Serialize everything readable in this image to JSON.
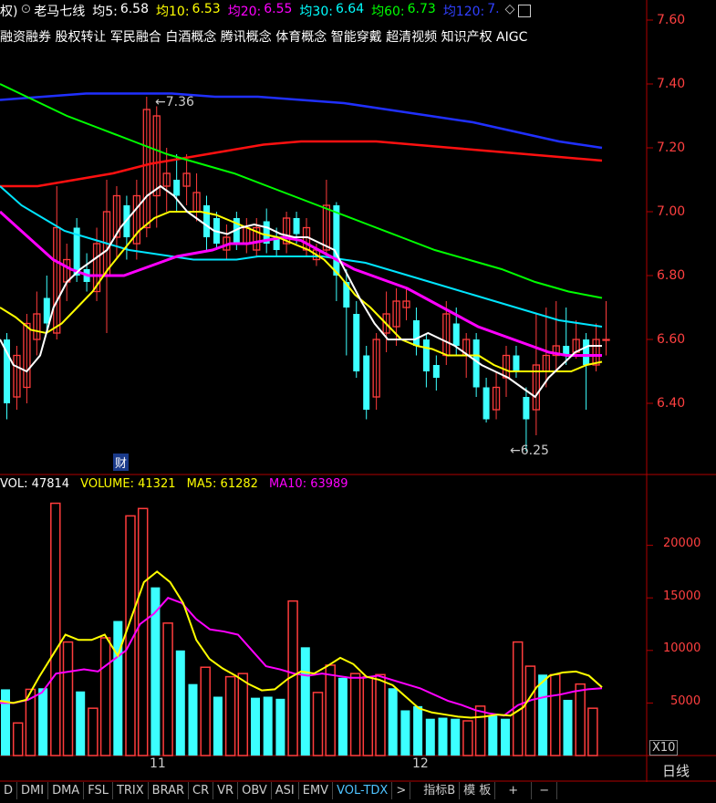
{
  "header": {
    "prefix": "权)",
    "stock_name": "老马七线",
    "ma5": {
      "label": "均5:",
      "value": "6.58",
      "color": "#ffffff"
    },
    "ma10": {
      "label": "均10:",
      "value": "6.53",
      "color": "#ffff00"
    },
    "ma20": {
      "label": "均20:",
      "value": "6.55",
      "color": "#ff00ff"
    },
    "ma30": {
      "label": "均30:",
      "value": "6.64",
      "color": "#00ffff"
    },
    "ma60": {
      "label": "均60:",
      "value": "6.73",
      "color": "#00ff00"
    },
    "ma120": {
      "label": "均120:",
      "value": "7.",
      "color": "#3040ff"
    }
  },
  "concepts": "融资融券 股权转让 军民融合 白酒概念 腾讯概念 体育概念 智能穿戴 超清视频 知识产权 AIGC",
  "price_axis": [
    "7.60",
    "7.40",
    "7.20",
    "7.00",
    "6.80",
    "6.60",
    "6.40"
  ],
  "annotations": {
    "high": "7.36",
    "low": "6.25",
    "cai": "财"
  },
  "volume_header": {
    "vol": {
      "label": "VOL:",
      "value": "47814",
      "color": "#ffffff"
    },
    "volume": {
      "label": "VOLUME:",
      "value": "41321",
      "color": "#ffff00"
    },
    "ma5": {
      "label": "MA5:",
      "value": "61282",
      "color": "#ffff00"
    },
    "ma10": {
      "label": "MA10:",
      "value": "63989",
      "color": "#ff00ff"
    }
  },
  "volume_axis": [
    "20000",
    "15000",
    "10000",
    "5000"
  ],
  "volume_unit": "X10",
  "x_axis": [
    "11",
    "12"
  ],
  "period": "日线",
  "tabs": [
    "D",
    "DMI",
    "DMA",
    "FSL",
    "TRIX",
    "BRAR",
    "CR",
    "VR",
    "OBV",
    "ASI",
    "EMV",
    "VOL-TDX",
    ">",
    "指标B",
    "模 板",
    "+",
    "−"
  ],
  "active_tab": "VOL-TDX",
  "chart_data": {
    "type": "candlestick",
    "candles": [
      {
        "o": 6.4,
        "c": 6.6,
        "h": 6.62,
        "l": 6.35,
        "up": false
      },
      {
        "o": 6.42,
        "c": 6.55,
        "h": 6.58,
        "l": 6.38,
        "up": true
      },
      {
        "o": 6.45,
        "c": 6.65,
        "h": 6.68,
        "l": 6.4,
        "up": true
      },
      {
        "o": 6.6,
        "c": 6.68,
        "h": 6.75,
        "l": 6.55,
        "up": true
      },
      {
        "o": 6.65,
        "c": 6.73,
        "h": 6.8,
        "l": 6.62,
        "up": false
      },
      {
        "o": 6.62,
        "c": 6.95,
        "h": 7.08,
        "l": 6.6,
        "up": true
      },
      {
        "o": 6.78,
        "c": 6.85,
        "h": 6.9,
        "l": 6.72,
        "up": true
      },
      {
        "o": 6.8,
        "c": 6.95,
        "h": 6.98,
        "l": 6.78,
        "up": false
      },
      {
        "o": 6.78,
        "c": 6.82,
        "h": 6.87,
        "l": 6.75,
        "up": false
      },
      {
        "o": 6.75,
        "c": 6.9,
        "h": 6.95,
        "l": 6.72,
        "up": true
      },
      {
        "o": 6.8,
        "c": 7.0,
        "h": 7.1,
        "l": 6.62,
        "up": true
      },
      {
        "o": 6.92,
        "c": 7.05,
        "h": 7.08,
        "l": 6.85,
        "up": true
      },
      {
        "o": 6.92,
        "c": 7.02,
        "h": 7.05,
        "l": 6.85,
        "up": false
      },
      {
        "o": 6.9,
        "c": 7.05,
        "h": 7.1,
        "l": 6.85,
        "up": true
      },
      {
        "o": 6.95,
        "c": 7.32,
        "h": 7.36,
        "l": 6.92,
        "up": true
      },
      {
        "o": 7.3,
        "c": 7.05,
        "h": 7.33,
        "l": 6.95,
        "up": true
      },
      {
        "o": 7.08,
        "c": 7.12,
        "h": 7.2,
        "l": 7.0,
        "up": true
      },
      {
        "o": 7.1,
        "c": 7.05,
        "h": 7.18,
        "l": 7.0,
        "up": false
      },
      {
        "o": 7.12,
        "c": 7.08,
        "h": 7.18,
        "l": 7.02,
        "up": true
      },
      {
        "o": 7.06,
        "c": 7.0,
        "h": 7.12,
        "l": 6.97,
        "up": true
      },
      {
        "o": 7.02,
        "c": 6.92,
        "h": 7.05,
        "l": 6.88,
        "up": false
      },
      {
        "o": 6.98,
        "c": 6.9,
        "h": 7.0,
        "l": 6.88,
        "up": false
      },
      {
        "o": 6.92,
        "c": 6.88,
        "h": 6.96,
        "l": 6.85,
        "up": true
      },
      {
        "o": 6.98,
        "c": 6.9,
        "h": 7.0,
        "l": 6.88,
        "up": false
      },
      {
        "o": 6.9,
        "c": 6.95,
        "h": 6.98,
        "l": 6.87,
        "up": true
      },
      {
        "o": 6.95,
        "c": 6.88,
        "h": 6.98,
        "l": 6.86,
        "up": true
      },
      {
        "o": 6.97,
        "c": 6.9,
        "h": 7.01,
        "l": 6.87,
        "up": false
      },
      {
        "o": 6.92,
        "c": 6.88,
        "h": 6.95,
        "l": 6.86,
        "up": false
      },
      {
        "o": 6.98,
        "c": 6.9,
        "h": 7.0,
        "l": 6.87,
        "up": true
      },
      {
        "o": 6.98,
        "c": 6.93,
        "h": 7.0,
        "l": 6.9,
        "up": false
      },
      {
        "o": 6.95,
        "c": 6.88,
        "h": 6.98,
        "l": 6.86,
        "up": true
      },
      {
        "o": 6.85,
        "c": 6.88,
        "h": 6.9,
        "l": 6.83,
        "up": true
      },
      {
        "o": 6.88,
        "c": 7.02,
        "h": 7.1,
        "l": 6.86,
        "up": true
      },
      {
        "o": 7.02,
        "c": 6.8,
        "h": 7.03,
        "l": 6.72,
        "up": false
      },
      {
        "o": 6.78,
        "c": 6.7,
        "h": 6.82,
        "l": 6.55,
        "up": false
      },
      {
        "o": 6.68,
        "c": 6.5,
        "h": 6.72,
        "l": 6.48,
        "up": false
      },
      {
        "o": 6.55,
        "c": 6.38,
        "h": 6.58,
        "l": 6.35,
        "up": false
      },
      {
        "o": 6.42,
        "c": 6.6,
        "h": 6.62,
        "l": 6.38,
        "up": true
      },
      {
        "o": 6.62,
        "c": 6.68,
        "h": 6.75,
        "l": 6.56,
        "up": true
      },
      {
        "o": 6.64,
        "c": 6.72,
        "h": 6.76,
        "l": 6.58,
        "up": true
      },
      {
        "o": 6.7,
        "c": 6.72,
        "h": 6.76,
        "l": 6.66,
        "up": true
      },
      {
        "o": 6.66,
        "c": 6.58,
        "h": 6.7,
        "l": 6.55,
        "up": false
      },
      {
        "o": 6.6,
        "c": 6.5,
        "h": 6.62,
        "l": 6.45,
        "up": false
      },
      {
        "o": 6.52,
        "c": 6.48,
        "h": 6.55,
        "l": 6.44,
        "up": false
      },
      {
        "o": 6.55,
        "c": 6.68,
        "h": 6.72,
        "l": 6.52,
        "up": true
      },
      {
        "o": 6.65,
        "c": 6.58,
        "h": 6.7,
        "l": 6.55,
        "up": false
      },
      {
        "o": 6.55,
        "c": 6.6,
        "h": 6.62,
        "l": 6.48,
        "up": true
      },
      {
        "o": 6.6,
        "c": 6.45,
        "h": 6.62,
        "l": 6.42,
        "up": false
      },
      {
        "o": 6.45,
        "c": 6.35,
        "h": 6.48,
        "l": 6.34,
        "up": false
      },
      {
        "o": 6.38,
        "c": 6.45,
        "h": 6.5,
        "l": 6.35,
        "up": true
      },
      {
        "o": 6.48,
        "c": 6.55,
        "h": 6.58,
        "l": 6.42,
        "up": true
      },
      {
        "o": 6.55,
        "c": 6.5,
        "h": 6.58,
        "l": 6.48,
        "up": false
      },
      {
        "o": 6.42,
        "c": 6.35,
        "h": 6.45,
        "l": 6.25,
        "up": false
      },
      {
        "o": 6.38,
        "c": 6.52,
        "h": 6.68,
        "l": 6.3,
        "up": true
      },
      {
        "o": 6.5,
        "c": 6.55,
        "h": 6.7,
        "l": 6.45,
        "up": true
      },
      {
        "o": 6.55,
        "c": 6.58,
        "h": 6.72,
        "l": 6.5,
        "up": true
      },
      {
        "o": 6.58,
        "c": 6.55,
        "h": 6.7,
        "l": 6.52,
        "up": false
      },
      {
        "o": 6.56,
        "c": 6.6,
        "h": 6.66,
        "l": 6.54,
        "up": true
      },
      {
        "o": 6.6,
        "c": 6.52,
        "h": 6.62,
        "l": 6.38,
        "up": false
      },
      {
        "o": 6.52,
        "c": 6.6,
        "h": 6.65,
        "l": 6.5,
        "up": true
      },
      {
        "o": 6.6,
        "c": 6.6,
        "h": 6.72,
        "l": 6.55,
        "up": true
      }
    ],
    "ma5": [
      6.6,
      6.52,
      6.5,
      6.55,
      6.7,
      6.78,
      6.82,
      6.85,
      6.88,
      6.95,
      7.0,
      7.05,
      7.08,
      7.05,
      7.0,
      6.97,
      6.94,
      6.93,
      6.95,
      6.96,
      6.95,
      6.93,
      6.92,
      6.92,
      6.9,
      6.88,
      6.8,
      6.72,
      6.65,
      6.6,
      6.6,
      6.6,
      6.62,
      6.6,
      6.58,
      6.55,
      6.52,
      6.5,
      6.48,
      6.45,
      6.42,
      6.48,
      6.52,
      6.56,
      6.58,
      6.58
    ],
    "ma10": [
      6.7,
      6.67,
      6.63,
      6.62,
      6.65,
      6.7,
      6.75,
      6.82,
      6.88,
      6.94,
      6.98,
      7.0,
      7.0,
      7.0,
      6.99,
      6.97,
      6.95,
      6.93,
      6.92,
      6.9,
      6.88,
      6.85,
      6.8,
      6.74,
      6.7,
      6.65,
      6.6,
      6.58,
      6.57,
      6.55,
      6.55,
      6.55,
      6.52,
      6.5,
      6.5,
      6.5,
      6.5,
      6.5,
      6.52,
      6.53
    ],
    "ma20": [
      7.0,
      6.95,
      6.9,
      6.85,
      6.82,
      6.8,
      6.8,
      6.8,
      6.82,
      6.84,
      6.86,
      6.87,
      6.88,
      6.9,
      6.9,
      6.91,
      6.92,
      6.91,
      6.88,
      6.85,
      6.82,
      6.8,
      6.78,
      6.76,
      6.73,
      6.7,
      6.67,
      6.64,
      6.62,
      6.6,
      6.58,
      6.56,
      6.55,
      6.55,
      6.55
    ],
    "ma30": [
      7.08,
      7.02,
      6.98,
      6.94,
      6.92,
      6.9,
      6.88,
      6.87,
      6.86,
      6.85,
      6.85,
      6.85,
      6.86,
      6.86,
      6.86,
      6.86,
      6.85,
      6.84,
      6.82,
      6.8,
      6.78,
      6.76,
      6.74,
      6.72,
      6.7,
      6.68,
      6.66,
      6.65,
      6.64
    ],
    "ma60": [
      7.4,
      7.35,
      7.3,
      7.26,
      7.22,
      7.18,
      7.15,
      7.12,
      7.08,
      7.04,
      7.0,
      6.96,
      6.92,
      6.88,
      6.85,
      6.82,
      6.78,
      6.75,
      6.73
    ],
    "ma120": [
      7.35,
      7.36,
      7.37,
      7.37,
      7.37,
      7.36,
      7.36,
      7.35,
      7.34,
      7.32,
      7.3,
      7.28,
      7.25,
      7.22,
      7.2
    ],
    "ma_red": [
      7.08,
      7.08,
      7.1,
      7.12,
      7.15,
      7.17,
      7.19,
      7.21,
      7.22,
      7.22,
      7.22,
      7.21,
      7.2,
      7.19,
      7.18,
      7.17,
      7.16
    ],
    "volume": [
      {
        "v": 6300,
        "up": false
      },
      {
        "v": 3100,
        "up": true
      },
      {
        "v": 6300,
        "up": true
      },
      {
        "v": 6400,
        "up": false
      },
      {
        "v": 24000,
        "up": true
      },
      {
        "v": 10800,
        "up": true
      },
      {
        "v": 6100,
        "up": false
      },
      {
        "v": 4500,
        "up": true
      },
      {
        "v": 11200,
        "up": true
      },
      {
        "v": 12800,
        "up": false
      },
      {
        "v": 22800,
        "up": true
      },
      {
        "v": 23500,
        "up": true
      },
      {
        "v": 16000,
        "up": false
      },
      {
        "v": 12600,
        "up": true
      },
      {
        "v": 10000,
        "up": false
      },
      {
        "v": 6800,
        "up": false
      },
      {
        "v": 8400,
        "up": true
      },
      {
        "v": 5600,
        "up": false
      },
      {
        "v": 7500,
        "up": true
      },
      {
        "v": 7800,
        "up": true
      },
      {
        "v": 5500,
        "up": false
      },
      {
        "v": 5600,
        "up": false
      },
      {
        "v": 5400,
        "up": false
      },
      {
        "v": 14700,
        "up": true
      },
      {
        "v": 10300,
        "up": false
      },
      {
        "v": 6000,
        "up": true
      },
      {
        "v": 8600,
        "up": true
      },
      {
        "v": 7400,
        "up": false
      },
      {
        "v": 7800,
        "up": true
      },
      {
        "v": 7500,
        "up": true
      },
      {
        "v": 7700,
        "up": true
      },
      {
        "v": 6400,
        "up": false
      },
      {
        "v": 4300,
        "up": false
      },
      {
        "v": 4700,
        "up": false
      },
      {
        "v": 3500,
        "up": false
      },
      {
        "v": 3600,
        "up": false
      },
      {
        "v": 3500,
        "up": false
      },
      {
        "v": 3300,
        "up": true
      },
      {
        "v": 4700,
        "up": true
      },
      {
        "v": 3800,
        "up": false
      },
      {
        "v": 3500,
        "up": false
      },
      {
        "v": 10800,
        "up": true
      },
      {
        "v": 8500,
        "up": true
      },
      {
        "v": 7700,
        "up": false
      },
      {
        "v": 7700,
        "up": true
      },
      {
        "v": 5300,
        "up": false
      },
      {
        "v": 6800,
        "up": true
      },
      {
        "v": 4500,
        "up": true
      }
    ],
    "vol_ma5": [
      5200,
      5000,
      5300,
      7500,
      9500,
      11500,
      11000,
      11000,
      11500,
      9500,
      13000,
      16500,
      17500,
      16500,
      14500,
      11000,
      9200,
      8300,
      7600,
      6800,
      6200,
      6300,
      7300,
      8000,
      7800,
      8500,
      9300,
      8700,
      7500,
      7200,
      6700,
      5600,
      4500,
      4100,
      3900,
      3700,
      3600,
      3700,
      3900,
      3800,
      4600,
      6500,
      7600,
      7900,
      8000,
      7600,
      6500
    ],
    "vol_ma10": [
      5000,
      5000,
      5300,
      6000,
      7800,
      8000,
      8200,
      8000,
      9000,
      10000,
      12500,
      13500,
      15000,
      14500,
      13000,
      12000,
      11800,
      11500,
      10000,
      8500,
      8200,
      7800,
      7600,
      7800,
      7600,
      7400,
      7400,
      7600,
      7200,
      6800,
      6400,
      5800,
      5200,
      4800,
      4300,
      4000,
      3800,
      4800,
      5300,
      5600,
      5800,
      6100,
      6300,
      6400
    ]
  }
}
